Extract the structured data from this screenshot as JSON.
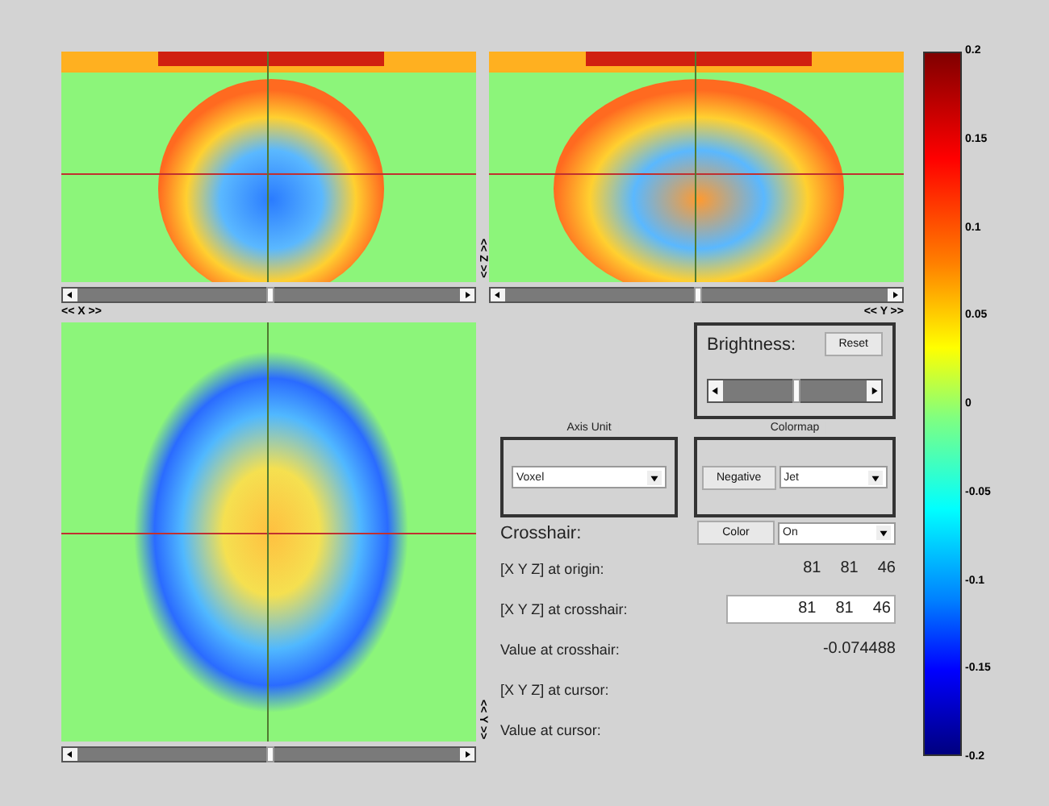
{
  "views": [
    {
      "label": "<< X >>",
      "slider": {
        "level": 0.5
      }
    },
    {
      "label": "<< Y >>",
      "slider": {
        "level": 0.5
      }
    },
    {
      "label": "<< Y >>",
      "slider": {
        "level": 0.5
      }
    }
  ],
  "side_label": "<< Z >>",
  "brightness": {
    "label": "Brightness:",
    "button": "Reset",
    "level": 0.5
  },
  "axis_unit": {
    "title": "Axis Unit",
    "value": "Voxel"
  },
  "colormap": {
    "title": "Colormap",
    "button": "Negative",
    "value": "Jet"
  },
  "crosshair": {
    "label": "Crosshair:",
    "button": "Color",
    "value": "On"
  },
  "info_rows": [
    {
      "label": "[X Y Z] at origin:",
      "kind": "plain",
      "values": [
        "81",
        "81",
        "46"
      ]
    },
    {
      "label": "[X Y Z] at crosshair:",
      "kind": "field",
      "values": [
        "81",
        "81",
        "46"
      ]
    },
    {
      "label": "Value at crosshair:",
      "kind": "plain",
      "values": [
        "-0.074488"
      ]
    },
    {
      "label": "[X Y Z] at cursor:",
      "kind": "plain"
    },
    {
      "label": "Value at cursor:",
      "kind": "plain"
    }
  ],
  "colorbar": {
    "ticks": [
      "0.2",
      "0.15",
      "0.1",
      "0.05",
      "0",
      "-0.05",
      "-0.1",
      "-0.15",
      "-0.2"
    ]
  }
}
